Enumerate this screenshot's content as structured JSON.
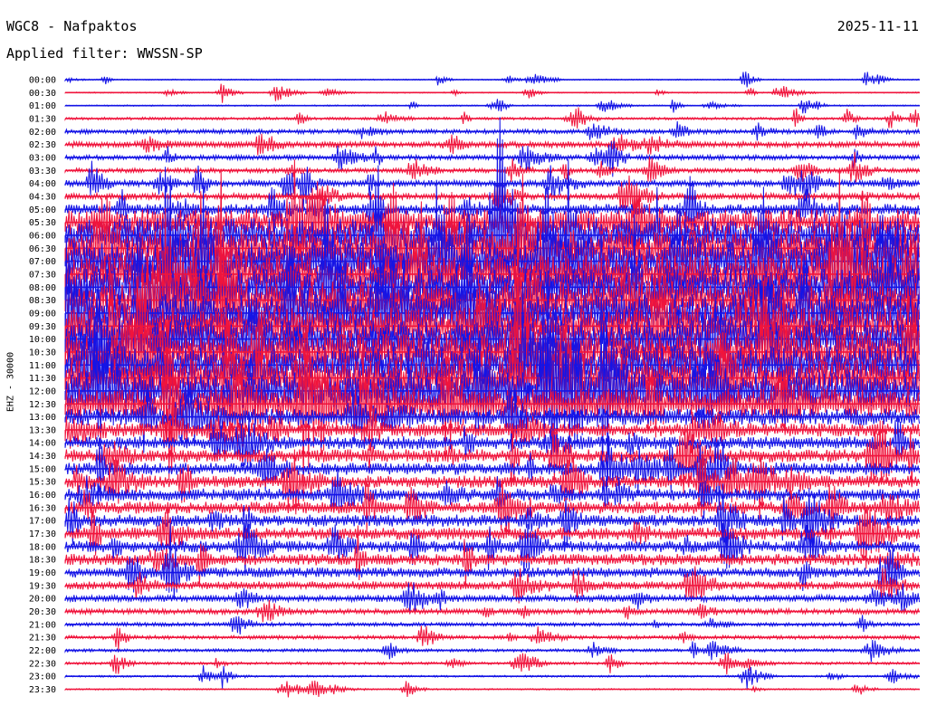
{
  "header": {
    "station": "WGC8 - Nafpaktos",
    "date": "2025-11-11",
    "filter": "Applied filter: WWSSN-SP"
  },
  "channel_label": "EHZ - 30000",
  "colors": {
    "trace_a": "#1414e6",
    "trace_b": "#f0143c",
    "text": "#000000",
    "background": "#ffffff"
  },
  "chart_data": {
    "type": "line",
    "title": "WGC8 - Nafpaktos",
    "subtitle": "Applied filter: WWSSN-SP",
    "ylabel": "EHZ - 30000",
    "xlabel": "",
    "grid": false,
    "row_labels": [
      "00:00",
      "00:30",
      "01:00",
      "01:30",
      "02:00",
      "02:30",
      "03:00",
      "03:30",
      "04:00",
      "04:30",
      "05:00",
      "05:30",
      "06:00",
      "06:30",
      "07:00",
      "07:30",
      "08:00",
      "08:30",
      "09:00",
      "09:30",
      "10:00",
      "10:30",
      "11:00",
      "11:30",
      "12:00",
      "12:30",
      "13:00",
      "13:30",
      "14:00",
      "14:30",
      "15:00",
      "15:30",
      "16:00",
      "16:30",
      "17:00",
      "17:30",
      "18:00",
      "18:30",
      "19:00",
      "19:30",
      "20:00",
      "20:30",
      "21:00",
      "21:30",
      "22:00",
      "22:30",
      "23:00",
      "23:30"
    ],
    "relative_amplitude": [
      0.15,
      0.15,
      0.18,
      0.35,
      0.6,
      0.8,
      0.65,
      0.6,
      0.85,
      0.85,
      1.4,
      3.5,
      4.5,
      5.0,
      5.0,
      5.0,
      5.0,
      5.0,
      5.0,
      5.0,
      5.0,
      5.0,
      5.0,
      5.0,
      5.0,
      4.0,
      2.2,
      1.8,
      1.7,
      1.7,
      1.6,
      1.6,
      1.6,
      1.6,
      1.6,
      1.6,
      1.5,
      1.5,
      1.3,
      1.1,
      0.9,
      0.7,
      0.5,
      0.5,
      0.4,
      0.35,
      0.25,
      0.2
    ],
    "series": [
      {
        "values": [
          "00:00",
          "01:00",
          "02:00",
          "03:00",
          "04:00",
          "05:00",
          "06:00",
          "07:00",
          "08:00",
          "09:00",
          "10:00",
          "11:00",
          "12:00",
          "13:00",
          "14:00",
          "15:00",
          "16:00",
          "17:00",
          "18:00",
          "19:00",
          "20:00",
          "21:00",
          "22:00",
          "23:00"
        ]
      },
      {
        "values": [
          "00:30",
          "01:30",
          "02:30",
          "03:30",
          "04:30",
          "05:30",
          "06:30",
          "07:30",
          "08:30",
          "09:30",
          "10:30",
          "11:30",
          "12:30",
          "13:30",
          "14:30",
          "15:30",
          "16:30",
          "17:30",
          "18:30",
          "19:30",
          "20:30",
          "21:30",
          "22:30",
          "23:30"
        ]
      }
    ]
  }
}
